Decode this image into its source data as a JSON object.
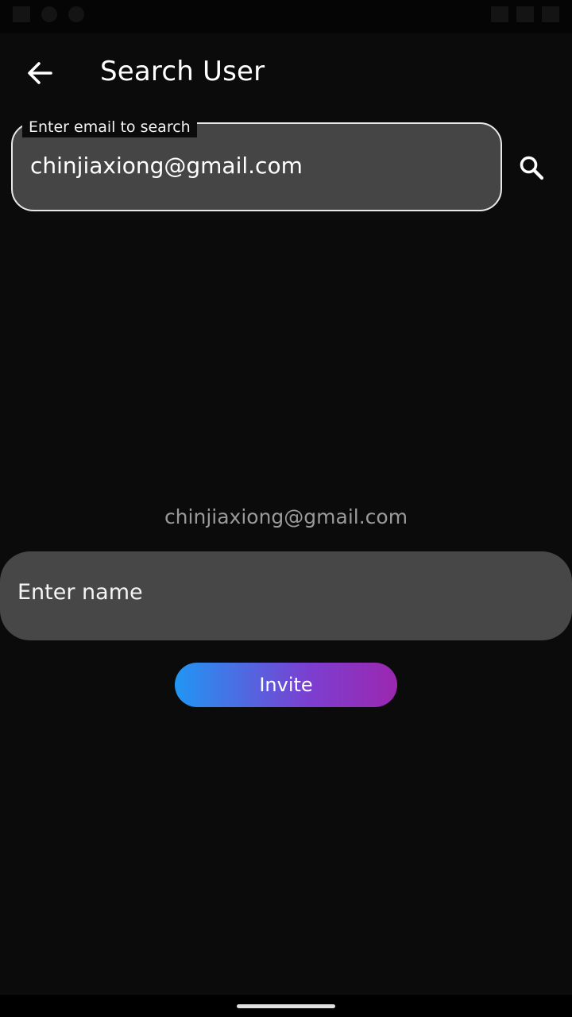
{
  "app_bar": {
    "title": "Search User",
    "back_icon": "arrow-left-icon"
  },
  "search": {
    "label": "Enter email to search",
    "value": "chinjiaxiong@gmail.com",
    "button_icon": "search-icon"
  },
  "result": {
    "email": "chinjiaxiong@gmail.com",
    "name_placeholder": "Enter name",
    "invite_label": "Invite"
  },
  "colors": {
    "background": "#0b0b0c",
    "field_fill": "#454545",
    "invite_gradient_start": "#2196f3",
    "invite_gradient_end": "#9c27b0"
  }
}
